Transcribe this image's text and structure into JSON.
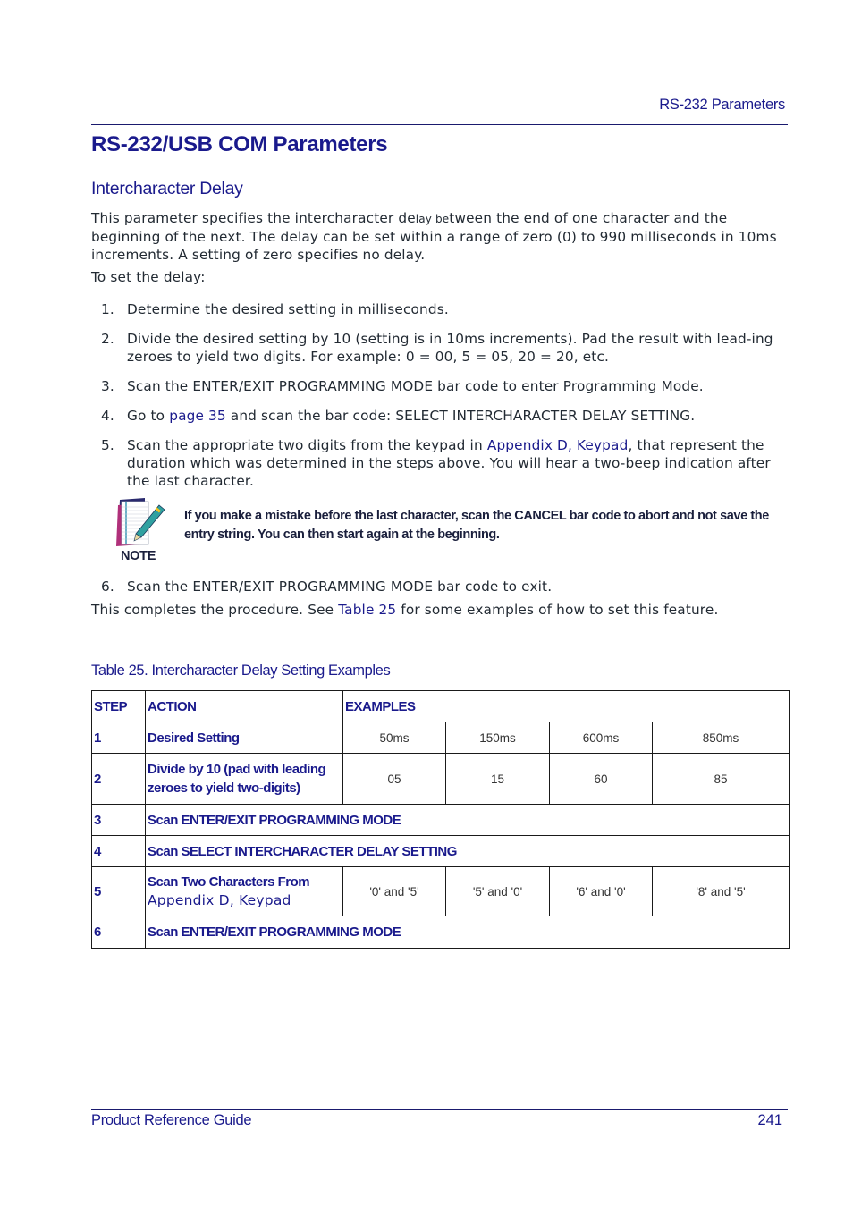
{
  "header": {
    "section": "RS-232 Parameters"
  },
  "title": "RS-232/USB COM Parameters",
  "subtitle": "Intercharacter Delay",
  "intro": {
    "part1": "This parameter specifies the intercharacter de",
    "part2": "lay be",
    "part3": "tween the end of one character and the beginning of the next. The delay can be set within a range of zero (0) to 990 milliseconds in 10ms increments. A setting of zero specifies no delay."
  },
  "to_set": "To set the delay:",
  "steps": [
    {
      "num": "1.",
      "text": "Determine the desired setting in milliseconds."
    },
    {
      "num": "2.",
      "text": "Divide the desired setting by 10 (setting is in 10ms increments). Pad the result with lead-ing zeroes to yield two digits. For example: 0 = 00, 5 = 05, 20 = 20, etc."
    },
    {
      "num": "3.",
      "text": "Scan the ENTER/EXIT PROGRAMMING MODE bar code to enter Programming Mode."
    },
    {
      "num": "4.",
      "pre": "Go to ",
      "link": "page 35",
      "post": " and scan the bar code: SELECT INTERCHARACTER DELAY SETTING."
    },
    {
      "num": "5.",
      "pre": "Scan the appropriate two digits from the keypad in ",
      "link": "Appendix D, Keypad",
      "post": ", that represent the duration which was determined in the steps above. You will hear a two-beep indication after the last character."
    },
    {
      "num": "6.",
      "text": "Scan the ENTER/EXIT PROGRAMMING MODE bar code to exit."
    }
  ],
  "note": {
    "label": "NOTE",
    "icon": "note-pad-pen-icon",
    "text": "If you make a mistake before the last character, scan the CANCEL bar code to abort and not save the entry string. You can then start again at the beginning."
  },
  "closing": {
    "pre": "This completes the procedure. See ",
    "link": "Table 25",
    "post": " for some examples of how to set this feature."
  },
  "table": {
    "caption": "Table 25. Intercharacter Delay Setting Examples",
    "headers": [
      "STEP",
      "ACTION",
      "EXAMPLES"
    ],
    "rows": [
      {
        "step": "1",
        "action": "Desired Setting",
        "examples": [
          "50ms",
          "150ms",
          "600ms",
          "850ms"
        ]
      },
      {
        "step": "2",
        "action": "Divide by 10 (pad with leading zeroes to yield two-digits)",
        "examples": [
          "05",
          "15",
          "60",
          "85"
        ]
      },
      {
        "step": "3",
        "action": "Scan ENTER/EXIT PROGRAMMING MODE"
      },
      {
        "step": "4",
        "action": "Scan SELECT INTERCHARACTER DELAY SETTING"
      },
      {
        "step": "5",
        "action": "Scan Two Characters From",
        "action_link": "Appendix D, Keypad",
        "examples": [
          "'0' and '5'",
          "'5' and '0'",
          "'6' and '0'",
          "'8' and '5'"
        ]
      },
      {
        "step": "6",
        "action": "Scan ENTER/EXIT PROGRAMMING MODE"
      }
    ]
  },
  "footer": {
    "guide": "Product Reference Guide",
    "page": "241"
  },
  "colors": {
    "brand_navy": "#1a1a8c",
    "body_text": "#222a33"
  }
}
